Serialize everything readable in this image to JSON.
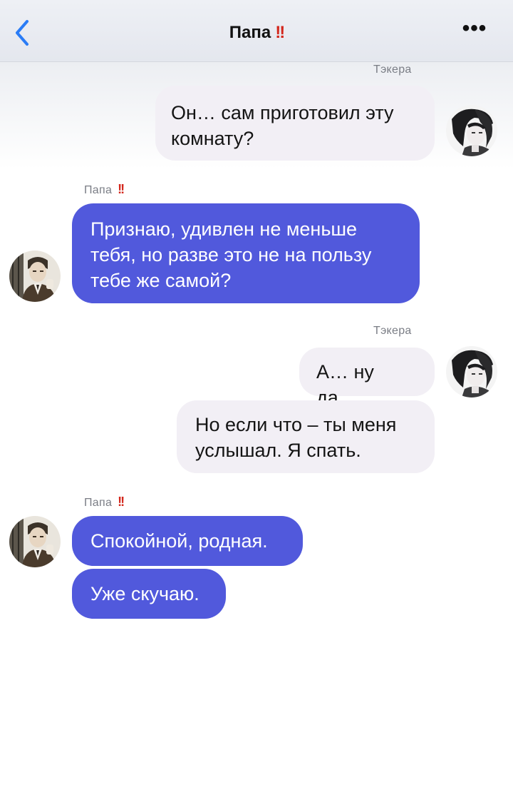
{
  "header": {
    "title": "Папа",
    "title_mark": "!!",
    "more_label": "•••"
  },
  "messages": [
    {
      "sender": "Тэкера",
      "text": "Он… сам приготовил эту\nкомнату?"
    },
    {
      "sender": "Папа",
      "sender_mark": "!!",
      "text": "Признаю, удивлен не меньше\nтебя, но разве это не на пользу\nтебе же самой?"
    },
    {
      "sender": "Тэкера",
      "text": "А… ну да…"
    },
    {
      "text": "Но если что – ты меня\nуслышал. Я спать."
    },
    {
      "sender": "Папа",
      "sender_mark": "!!",
      "text": "Спокойной, родная."
    },
    {
      "text": "Уже скучаю."
    }
  ],
  "colors": {
    "incoming_bubble": "#5159dc",
    "outgoing_bubble": "#f2eff5",
    "accent_back": "#2a7cf6",
    "exclamation": "#d3271c"
  },
  "icons": {
    "back": "chevron-left-icon",
    "more": "ellipsis-icon"
  }
}
